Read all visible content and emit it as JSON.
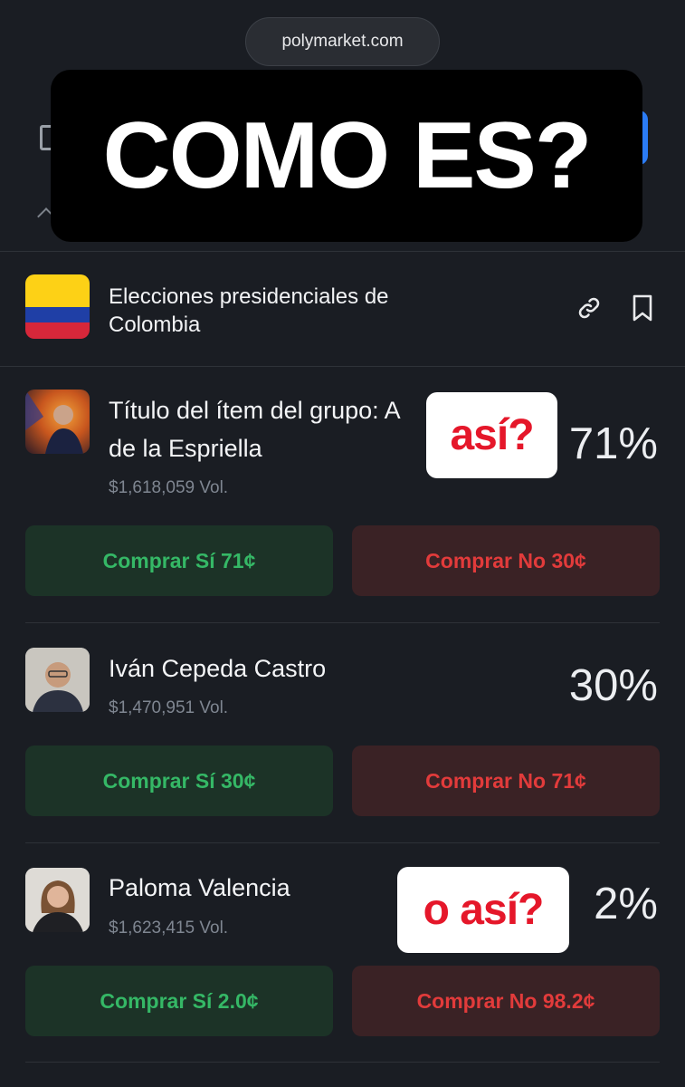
{
  "browser": {
    "url": "polymarket.com"
  },
  "overlay": {
    "title": "COMO ES?"
  },
  "event": {
    "title": "Elecciones presidenciales de Colombia"
  },
  "candidates": [
    {
      "name": "Título del ítem del grupo: A de la Espriella",
      "volume": "$1,618,059 Vol.",
      "percent": "71%",
      "buy_yes": "Comprar Sí 71¢",
      "buy_no": "Comprar No 30¢"
    },
    {
      "name": "Iván Cepeda Castro",
      "volume": "$1,470,951 Vol.",
      "percent": "30%",
      "buy_yes": "Comprar Sí 30¢",
      "buy_no": "Comprar No 71¢"
    },
    {
      "name": "Paloma Valencia",
      "volume": "$1,623,415 Vol.",
      "percent": "2%",
      "buy_yes": "Comprar Sí 2.0¢",
      "buy_no": "Comprar No 98.2¢"
    }
  ],
  "stickers": {
    "first": "así?",
    "second": "o así?"
  },
  "icons": {
    "share": "link-icon",
    "save": "bookmark-icon"
  },
  "colors": {
    "yes_text": "#35b866",
    "no_text": "#e23b3b",
    "sticker_text": "#e5172a"
  }
}
